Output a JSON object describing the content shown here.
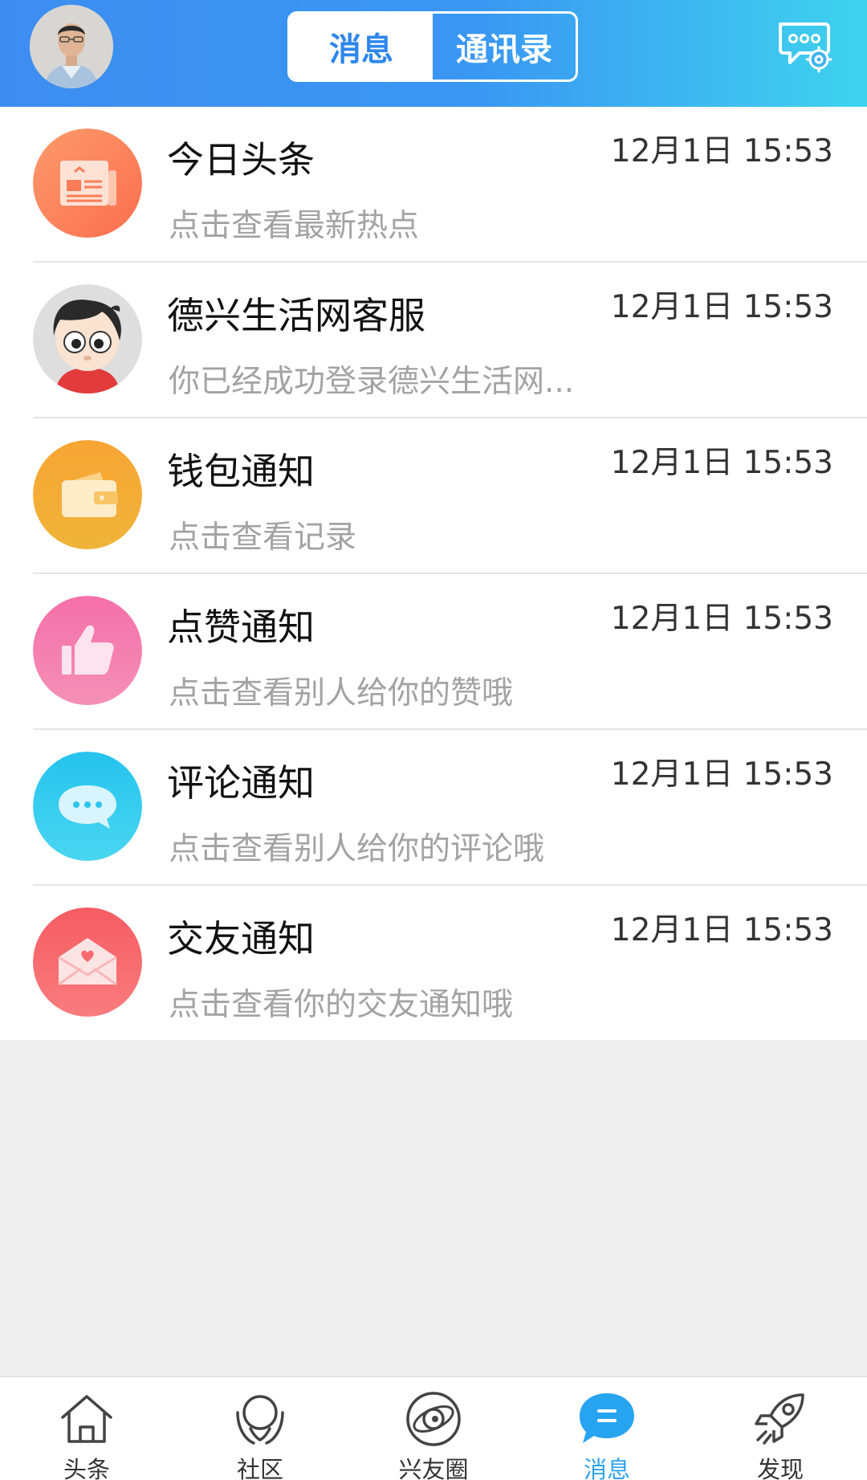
{
  "header": {
    "tabs": [
      {
        "label": "消息",
        "active": true
      },
      {
        "label": "通讯录",
        "active": false
      }
    ],
    "settings_icon": "chat-settings-icon",
    "colors": {
      "gradient_start": "#3d8df0",
      "gradient_end": "#3fd3ee",
      "active_tab_text": "#2f86ec"
    }
  },
  "messages": [
    {
      "title": "今日头条",
      "subtitle": "点击查看最新热点",
      "time": "12月1日 15:53",
      "icon": "newspaper-icon",
      "color": "#fb7f57"
    },
    {
      "title": "德兴生活网客服",
      "subtitle": "你已经成功登录德兴生活网...",
      "time": "12月1日 15:53",
      "icon": "cartoon-avatar-icon",
      "color": "#d9d9d9"
    },
    {
      "title": "钱包通知",
      "subtitle": "点击查看记录",
      "time": "12月1日 15:53",
      "icon": "wallet-icon",
      "color": "#f5a623"
    },
    {
      "title": "点赞通知",
      "subtitle": "点击查看别人给你的赞哦",
      "time": "12月1日 15:53",
      "icon": "thumbs-up-icon",
      "color": "#f177ab"
    },
    {
      "title": "评论通知",
      "subtitle": "点击查看别人给你的评论哦",
      "time": "12月1日 15:53",
      "icon": "speech-bubble-icon",
      "color": "#2fcaef"
    },
    {
      "title": "交友通知",
      "subtitle": "点击查看你的交友通知哦",
      "time": "12月1日 15:53",
      "icon": "love-letter-icon",
      "color": "#f7676c"
    }
  ],
  "bottom_nav": [
    {
      "label": "头条",
      "icon": "home-icon",
      "active": false
    },
    {
      "label": "社区",
      "icon": "community-icon",
      "active": false
    },
    {
      "label": "兴友圈",
      "icon": "orbit-icon",
      "active": false
    },
    {
      "label": "消息",
      "icon": "message-icon",
      "active": true
    },
    {
      "label": "发现",
      "icon": "rocket-icon",
      "active": false
    }
  ]
}
